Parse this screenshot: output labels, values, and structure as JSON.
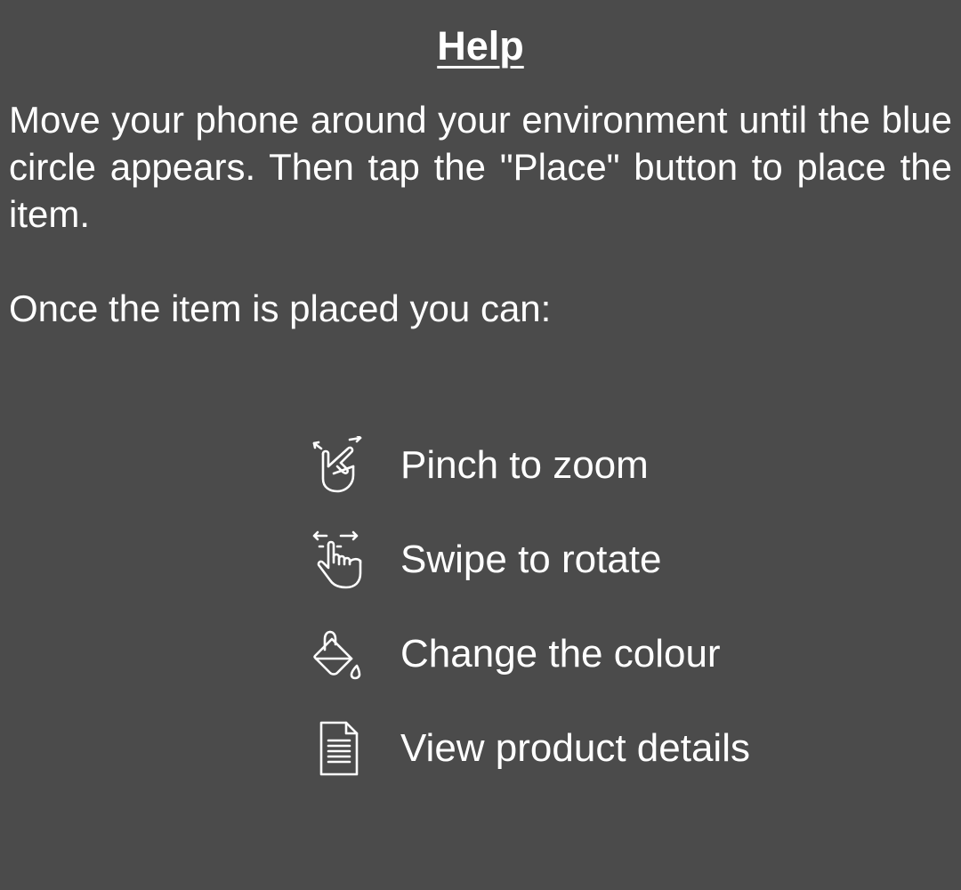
{
  "help": {
    "title": "Help",
    "intro": "Move your phone around your environment until the blue circle appears. Then tap the \"Place\" button to place the item.",
    "subintro": "Once the item is placed you can:",
    "features": [
      {
        "icon": "pinch-zoom-icon",
        "label": "Pinch to zoom"
      },
      {
        "icon": "swipe-rotate-icon",
        "label": "Swipe to rotate"
      },
      {
        "icon": "paint-bucket-icon",
        "label": "Change the colour"
      },
      {
        "icon": "document-icon",
        "label": "View product details"
      }
    ]
  },
  "colors": {
    "background": "#4b4b4b",
    "text": "#ffffff"
  }
}
